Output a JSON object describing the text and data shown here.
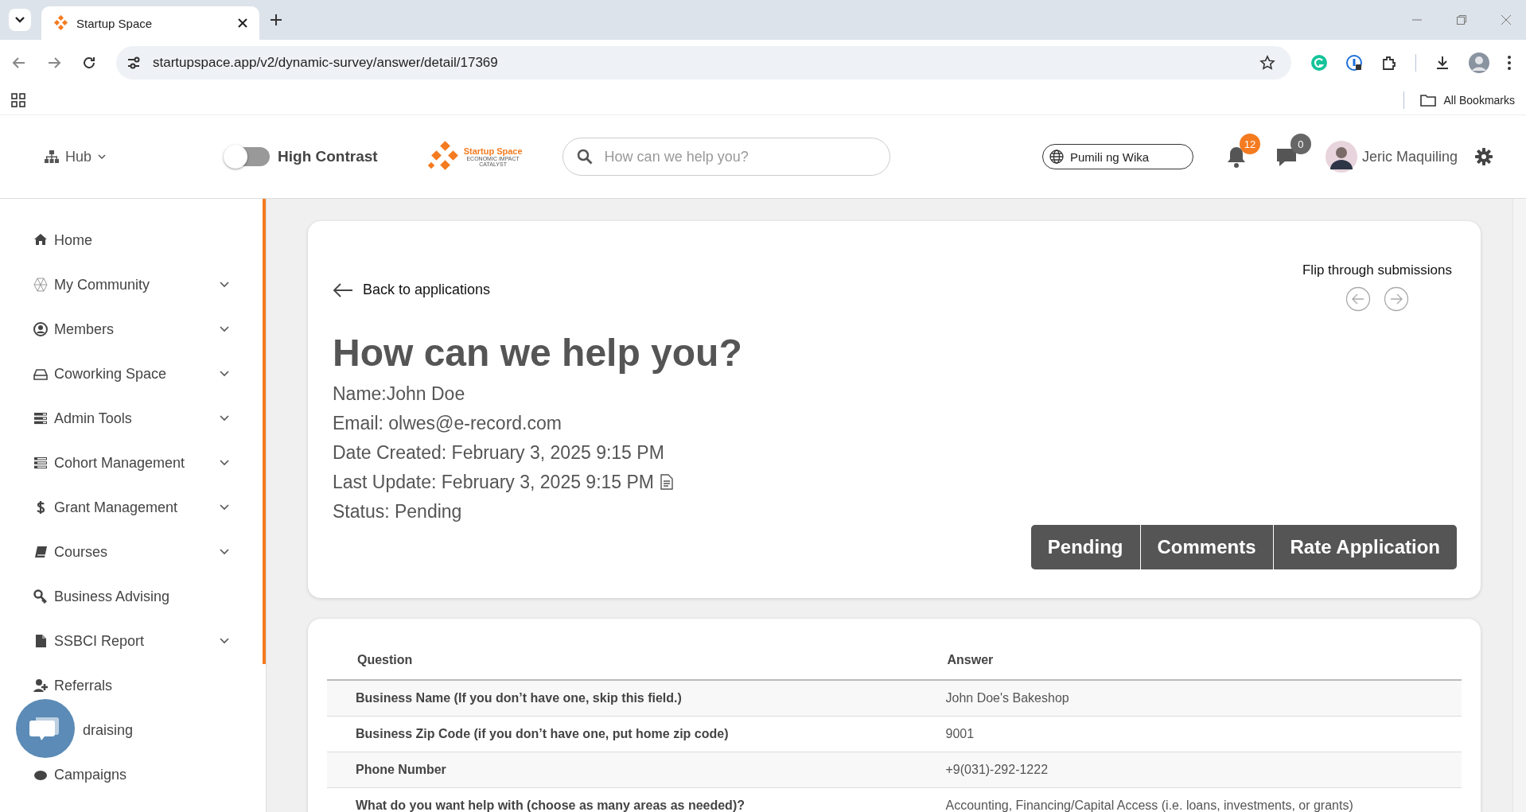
{
  "browser": {
    "tab_title": "Startup Space",
    "url": "startupspace.app/v2/dynamic-survey/answer/detail/17369",
    "bookmarks_label": "All Bookmarks"
  },
  "header": {
    "hub_label": "Hub",
    "high_contrast": {
      "label": "High Contrast",
      "on": false
    },
    "logo": {
      "name": "Startup Space",
      "tagline": "ECONOMIC IMPACT",
      "tagline2": "CATALYST"
    },
    "search": {
      "placeholder": "How can we help you?"
    },
    "language": "Pumili ng Wika",
    "notifications": "12",
    "messages": "0",
    "user_name": "Jeric Maquiling"
  },
  "sidebar": {
    "items": [
      {
        "label": "Home",
        "kind": "home",
        "expandable": false
      },
      {
        "label": "My Community",
        "kind": "community",
        "expandable": true
      },
      {
        "label": "Members",
        "kind": "members",
        "expandable": true
      },
      {
        "label": "Coworking Space",
        "kind": "coworking",
        "expandable": true
      },
      {
        "label": "Admin Tools",
        "kind": "admin",
        "expandable": true
      },
      {
        "label": "Cohort Management",
        "kind": "cohort",
        "expandable": true
      },
      {
        "label": "Grant Management",
        "kind": "grant",
        "expandable": true
      },
      {
        "label": "Courses",
        "kind": "courses",
        "expandable": true
      },
      {
        "label": "Business Advising",
        "kind": "advising",
        "expandable": false
      },
      {
        "label": "SSBCI Report",
        "kind": "report",
        "expandable": true
      },
      {
        "label": "Referrals",
        "kind": "referrals",
        "expandable": false
      },
      {
        "label": "draising",
        "kind": "covered",
        "expandable": false
      },
      {
        "label": "Campaigns",
        "kind": "campaigns",
        "expandable": false
      }
    ]
  },
  "detail": {
    "back_label": "Back to applications",
    "flip_label": "Flip through submissions",
    "title": "How can we help you?",
    "fields": [
      {
        "text": "Name:John Doe",
        "kind": "text"
      },
      {
        "text": "Email: olwes@e-record.com",
        "kind": "text"
      },
      {
        "text": "Date Created: February 3, 2025 9:15 PM",
        "kind": "text"
      },
      {
        "text": "Last Update: February 3, 2025 9:15 PM",
        "kind": "doc"
      },
      {
        "text": "Status: Pending",
        "kind": "text"
      }
    ],
    "buttons": [
      "Pending",
      "Comments",
      "Rate Application"
    ]
  },
  "table": {
    "columns": [
      "Question",
      "Answer"
    ],
    "rows": [
      {
        "question": "Business Name (If you don’t have one, skip this field.)",
        "answer": "John Doe's Bakeshop"
      },
      {
        "question": "Business Zip Code (if you don’t have one, put home zip code)",
        "answer": "9001"
      },
      {
        "question": "Phone Number",
        "answer": "+9(031)-292-1222"
      },
      {
        "question": "What do you want help with (choose as many areas as needed)?",
        "answer": "Accounting, Financing/Capital Access (i.e. loans, investments, or grants)"
      }
    ]
  }
}
